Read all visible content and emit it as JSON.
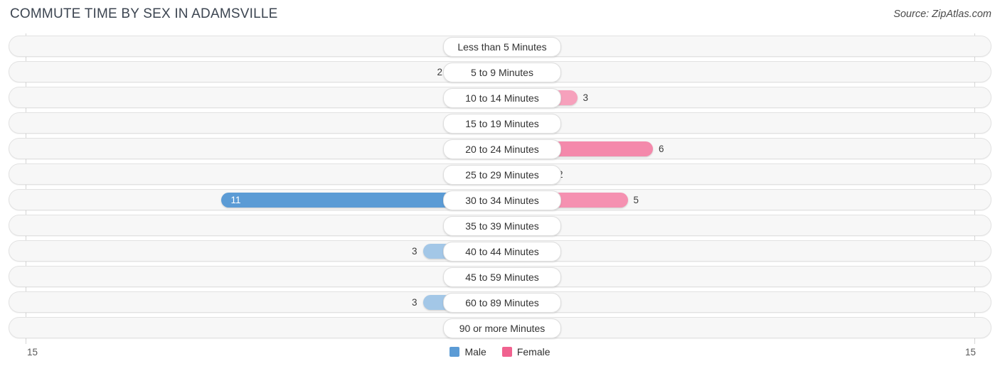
{
  "header": {
    "title": "COMMUTE TIME BY SEX IN ADAMSVILLE",
    "source": "Source: ZipAtlas.com"
  },
  "legend": {
    "male_label": "Male",
    "female_label": "Female",
    "male_color": "#5b9bd5",
    "female_color": "#f0628f"
  },
  "axis": {
    "left_label": "15",
    "right_label": "15"
  },
  "chart_data": {
    "type": "bar",
    "subtype": "diverging-bidirectional",
    "title": "COMMUTE TIME BY SEX IN ADAMSVILLE",
    "xlabel": "",
    "ylabel": "",
    "xlim": [
      15,
      15
    ],
    "grid": true,
    "legend_position": "bottom-center",
    "categories": [
      "Less than 5 Minutes",
      "5 to 9 Minutes",
      "10 to 14 Minutes",
      "15 to 19 Minutes",
      "20 to 24 Minutes",
      "25 to 29 Minutes",
      "30 to 34 Minutes",
      "35 to 39 Minutes",
      "40 to 44 Minutes",
      "45 to 59 Minutes",
      "60 to 89 Minutes",
      "90 or more Minutes"
    ],
    "series": [
      {
        "name": "Male",
        "color": "#5b9bd5",
        "direction": "left",
        "values": [
          0,
          2,
          0,
          0,
          0,
          0,
          11,
          0,
          3,
          0,
          3,
          0
        ]
      },
      {
        "name": "Female",
        "color": "#f0628f",
        "direction": "right",
        "values": [
          0,
          0,
          3,
          0,
          6,
          2,
          5,
          0,
          0,
          0,
          0,
          0
        ]
      }
    ]
  },
  "rows": [
    {
      "label": "Less than 5 Minutes",
      "male": "0",
      "female": "0"
    },
    {
      "label": "5 to 9 Minutes",
      "male": "2",
      "female": "0"
    },
    {
      "label": "10 to 14 Minutes",
      "male": "0",
      "female": "3"
    },
    {
      "label": "15 to 19 Minutes",
      "male": "0",
      "female": "0"
    },
    {
      "label": "20 to 24 Minutes",
      "male": "0",
      "female": "6"
    },
    {
      "label": "25 to 29 Minutes",
      "male": "0",
      "female": "2"
    },
    {
      "label": "30 to 34 Minutes",
      "male": "11",
      "female": "5"
    },
    {
      "label": "35 to 39 Minutes",
      "male": "0",
      "female": "0"
    },
    {
      "label": "40 to 44 Minutes",
      "male": "3",
      "female": "0"
    },
    {
      "label": "45 to 59 Minutes",
      "male": "0",
      "female": "0"
    },
    {
      "label": "60 to 89 Minutes",
      "male": "3",
      "female": "0"
    },
    {
      "label": "90 or more Minutes",
      "male": "0",
      "female": "0"
    }
  ]
}
